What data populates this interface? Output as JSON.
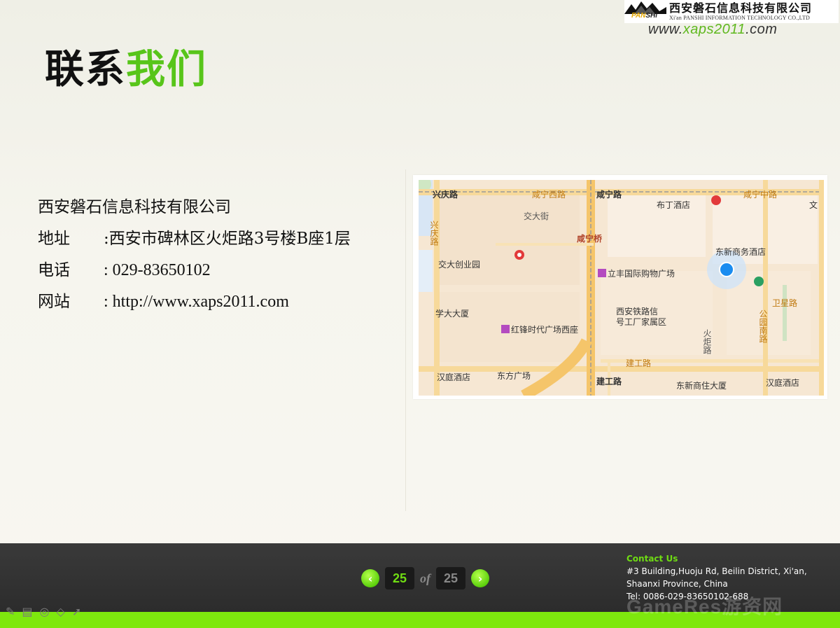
{
  "logo": {
    "brand_a": "PAN",
    "brand_b": "SHi",
    "cn": "西安磐石信息科技有限公司",
    "en": "Xi'an PANSHI INFORMATION TECHNOLOGY CO.,LTD"
  },
  "website_top": {
    "prefix": "www.",
    "highlight": "xaps2011",
    "suffix": ".com"
  },
  "title": {
    "part1": "联系",
    "part2": "我们"
  },
  "info": {
    "company": "西安磐石信息科技有限公司",
    "address_label": "地址",
    "address_value": ":西安市碑林区火炬路3号楼B座1层",
    "phone_label": "电话",
    "phone_value": ": 029-83650102",
    "site_label": "网站",
    "site_value": ": http://www.xaps2011.com"
  },
  "map": {
    "labels": {
      "xingqing_rd": "兴庆路",
      "xianning_west": "咸宁西路",
      "xianning_rd": "咸宁路",
      "xianning_mid": "咸宁中路",
      "budinghotel": "布丁酒店",
      "wen": "文",
      "xingqing_v": "兴庆路",
      "jiaoda_st": "交大街",
      "xianning_bridge": "咸宁桥",
      "dongxin_hotel": "东新商务酒店",
      "jiaoda_park": "交大创业园",
      "lifeng_mall": "立丰国际购物广场",
      "weixing_rd": "卫星路",
      "xueda": "学大大厦",
      "xiantie_1": "西安铁路信",
      "xiantie_2": "号工厂家属区",
      "gongyuan_nan": "公园南路",
      "hongfeng": "红锋时代广场西座",
      "huoju": "火炬路",
      "jiangong_rd": "建工路",
      "hanting": "汉庭酒店",
      "dongfang": "东方广场",
      "jiangong_rd2": "建工路",
      "dongxin_live": "东新商住大厦",
      "hanyuan": "汉庭酒店"
    }
  },
  "pager": {
    "current": "25",
    "of": "of",
    "total": "25"
  },
  "contact": {
    "title": "Contact Us",
    "line1": "#3 Building,Huoju Rd, Beilin District, Xi'an,",
    "line2": "Shaanxi Province, China",
    "line3": "Tel: 0086-029-83650102-688"
  },
  "watermark": "GameRes游资网",
  "colors": {
    "accent_green": "#58c51a",
    "bottom_bar": "#2f2f2f",
    "strip": "#7ee80e"
  }
}
